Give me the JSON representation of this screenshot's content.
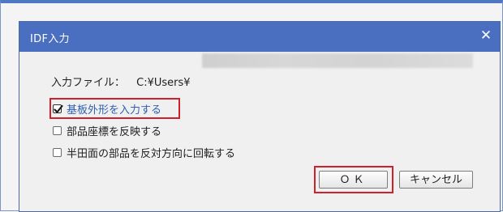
{
  "dialog": {
    "title": "IDF入力",
    "close_icon": "close-icon"
  },
  "file": {
    "label": "入力ファイル：",
    "path_visible": "C:¥Users¥"
  },
  "options": [
    {
      "label": "基板外形を入力する",
      "checked": true,
      "highlighted": true
    },
    {
      "label": "部品座標を反映する",
      "checked": false,
      "highlighted": false
    },
    {
      "label": "半田面の部品を反対方向に回転する",
      "checked": false,
      "highlighted": false
    }
  ],
  "buttons": {
    "ok_label": "ＯＫ",
    "cancel_label": "キャンセル"
  },
  "colors": {
    "titlebar": "#4a6fc0",
    "highlight": "#d0202b",
    "checked_label": "#2f5fb0"
  }
}
